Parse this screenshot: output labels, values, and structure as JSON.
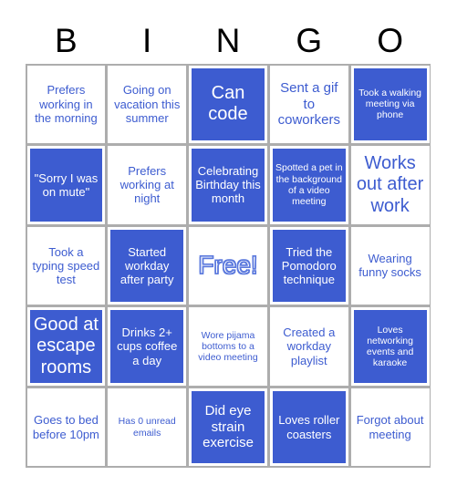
{
  "card": {
    "header_letters": [
      "B",
      "I",
      "N",
      "G",
      "O"
    ],
    "colors": {
      "marked_background": "#3d5cd0",
      "unmarked_background": "#ffffff",
      "marked_text": "#ffffff",
      "unmarked_text": "#3d5cd0",
      "grid_line": "#adadad",
      "header_text": "#000000",
      "free_outline": "#5a78dd"
    },
    "rows": [
      [
        {
          "label": "Prefers working in the morning",
          "marked": false,
          "size": "s"
        },
        {
          "label": "Going on vacation this summer",
          "marked": false,
          "size": "s"
        },
        {
          "label": "Can code",
          "marked": true,
          "size": "l"
        },
        {
          "label": "Sent a gif to coworkers",
          "marked": false,
          "size": "m"
        },
        {
          "label": "Took a walking meeting via phone",
          "marked": true,
          "size": "xs"
        }
      ],
      [
        {
          "label": "\"Sorry I was on mute\"",
          "marked": true,
          "size": "s"
        },
        {
          "label": "Prefers working at night",
          "marked": false,
          "size": "s"
        },
        {
          "label": "Celebrating Birthday this month",
          "marked": true,
          "size": "s"
        },
        {
          "label": "Spotted a pet in the background of a video meeting",
          "marked": true,
          "size": "xs"
        },
        {
          "label": "Works out after work",
          "marked": false,
          "size": "l"
        }
      ],
      [
        {
          "label": "Took a typing speed test",
          "marked": false,
          "size": "s"
        },
        {
          "label": "Started workday after party",
          "marked": true,
          "size": "s"
        },
        {
          "label": "Free!",
          "marked": false,
          "size": "free"
        },
        {
          "label": "Tried the Pomodoro technique",
          "marked": true,
          "size": "s"
        },
        {
          "label": "Wearing funny socks",
          "marked": false,
          "size": "s"
        }
      ],
      [
        {
          "label": "Good at escape rooms",
          "marked": true,
          "size": "l"
        },
        {
          "label": "Drinks 2+ cups coffee a day",
          "marked": true,
          "size": "s"
        },
        {
          "label": "Wore pijama bottoms to a video meeting",
          "marked": false,
          "size": "xs"
        },
        {
          "label": "Created a workday playlist",
          "marked": false,
          "size": "s"
        },
        {
          "label": "Loves networking events and karaoke",
          "marked": true,
          "size": "xs"
        }
      ],
      [
        {
          "label": "Goes to bed before 10pm",
          "marked": false,
          "size": "s"
        },
        {
          "label": "Has 0 unread emails",
          "marked": false,
          "size": "xs"
        },
        {
          "label": "Did eye strain exercise",
          "marked": true,
          "size": "m"
        },
        {
          "label": "Loves roller coasters",
          "marked": true,
          "size": "s"
        },
        {
          "label": "Forgot about meeting",
          "marked": false,
          "size": "s"
        }
      ]
    ]
  }
}
